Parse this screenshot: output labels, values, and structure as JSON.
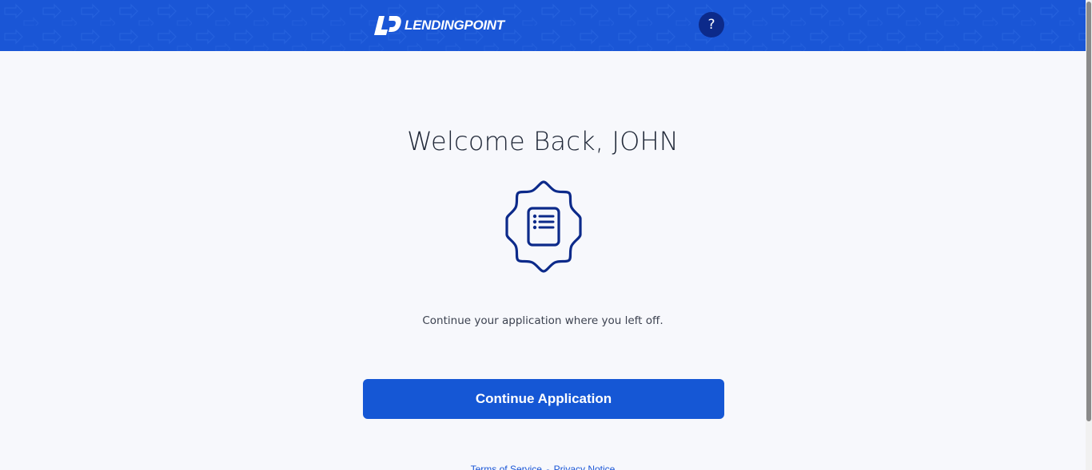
{
  "header": {
    "brand_name": "LENDINGPOINT",
    "help_label": "?"
  },
  "main": {
    "welcome_title": "Welcome Back, JOHN",
    "subtitle": "Continue your application where you left off.",
    "continue_button_label": "Continue Application"
  },
  "footer": {
    "terms_link": "Terms of Service",
    "separator": "-",
    "privacy_link": "Privacy Notice"
  },
  "colors": {
    "brand_blue": "#1a56d6",
    "button_blue": "#1557d5",
    "help_button_bg": "#0c2a8a",
    "icon_navy": "#0c2a8a",
    "page_background": "#f7f8fc"
  },
  "icons": {
    "logo": "lendingpoint-logo-icon",
    "badge": "document-badge-icon"
  }
}
